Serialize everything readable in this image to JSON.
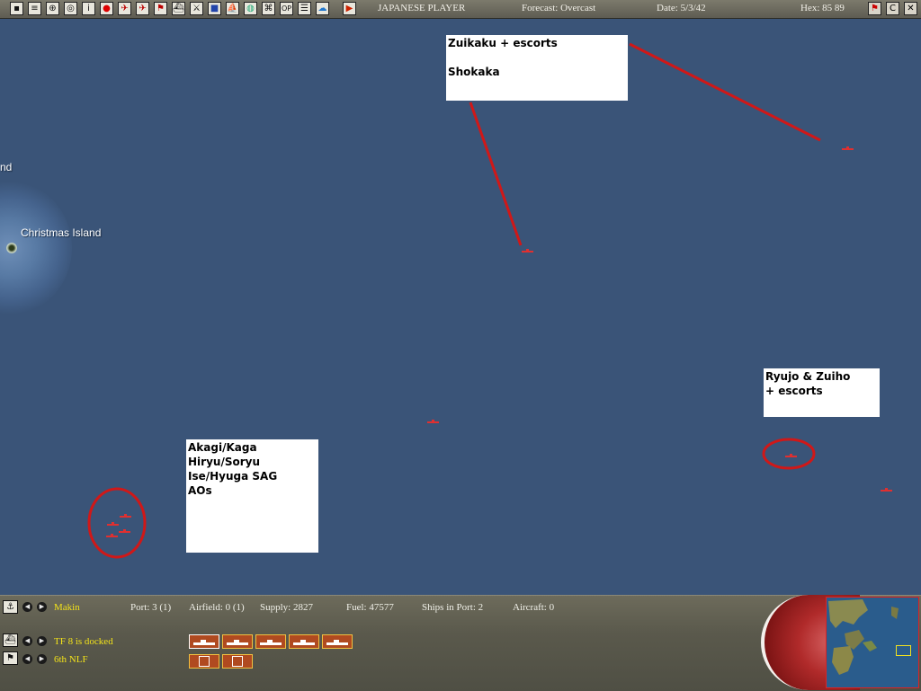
{
  "toolbar": {
    "player": "JAPANESE PLAYER",
    "forecast": "Forecast: Overcast",
    "date": "Date: 5/3/42",
    "hex": "Hex: 85 89",
    "icon_names": [
      "save-icon",
      "document-icon",
      "aircraft-transfer-icon",
      "fleet-icon",
      "info-icon",
      "japan-flag-icon",
      "air-unit-icon",
      "air-group-icon",
      "flag-icon",
      "ship-icon",
      "ground-unit-icon",
      "territory-icon",
      "taskforce-icon",
      "globe-icon",
      "intel-icon",
      "op-icon",
      "report-icon",
      "cloud-icon",
      "end-turn-icon"
    ],
    "right_icons": [
      "flag-toggle-icon",
      "c-button-icon",
      "close-icon"
    ]
  },
  "map": {
    "labels": {
      "partial": "nd",
      "christmas": "Christmas Island"
    },
    "notes": {
      "zuikaku": [
        "Zuikaku + escorts",
        "",
        "Shokaka"
      ],
      "ryujo": [
        "Ryujo & Zuiho",
        "+ escorts"
      ],
      "akagi": [
        "Akagi/Kaga",
        "Hiryu/Soryu",
        "Ise/Hyuga SAG",
        "AOs"
      ]
    },
    "line_color": "#d01818",
    "ship_color": "#e03030"
  },
  "panel": {
    "location": "Makin",
    "port": "Port: 3 (1)",
    "airfield": "Airfield: 0 (1)",
    "supply": "Supply: 2827",
    "fuel": "Fuel: 47577",
    "ships_in_port": "Ships in Port: 2",
    "aircraft": "Aircraft: 0",
    "taskforce": "TF 8 is docked",
    "unit": "6th NLF"
  }
}
